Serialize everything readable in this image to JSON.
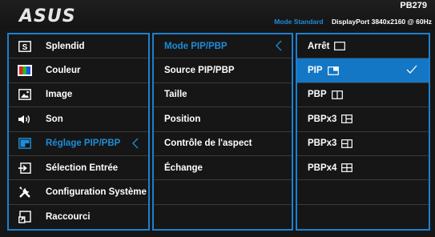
{
  "header": {
    "logo": "ASUS",
    "model": "PB279",
    "mode": "Mode Standard",
    "input_info": "DisplayPort  3840x2160 @ 60Hz"
  },
  "main_menu": {
    "items": [
      {
        "label": "Splendid",
        "icon": "splendid-s-icon"
      },
      {
        "label": "Couleur",
        "icon": "color-palette-icon"
      },
      {
        "label": "Image",
        "icon": "image-icon"
      },
      {
        "label": "Son",
        "icon": "speaker-icon"
      },
      {
        "label": "Réglage PIP/PBP",
        "icon": "pip-icon",
        "active": true
      },
      {
        "label": "Sélection Entrée",
        "icon": "input-select-icon"
      },
      {
        "label": "Configuration Système",
        "icon": "tools-icon"
      },
      {
        "label": "Raccourci",
        "icon": "shortcut-icon"
      }
    ]
  },
  "sub_menu": {
    "items": [
      {
        "label": "Mode PIP/PBP",
        "active": true
      },
      {
        "label": "Source PIP/PBP"
      },
      {
        "label": "Taille"
      },
      {
        "label": "Position"
      },
      {
        "label": "Contrôle de l'aspect"
      },
      {
        "label": "Échange"
      },
      {
        "label": ""
      },
      {
        "label": ""
      }
    ]
  },
  "options": {
    "items": [
      {
        "label": "Arrêt",
        "icon": "off-window-icon"
      },
      {
        "label": "PIP",
        "icon": "pip-window-icon",
        "selected": true
      },
      {
        "label": "PBP",
        "icon": "pbp-two-split-icon"
      },
      {
        "label": "PBPx3",
        "icon": "pbp-three-split-icon-a"
      },
      {
        "label": "PBPx3",
        "icon": "pbp-three-split-icon-b"
      },
      {
        "label": "PBPx4",
        "icon": "pbp-four-split-icon"
      },
      {
        "label": ""
      },
      {
        "label": ""
      }
    ]
  },
  "colors": {
    "accent": "#1e8cd8",
    "selected_bg": "#1377c6",
    "border": "#1d7fcf"
  }
}
